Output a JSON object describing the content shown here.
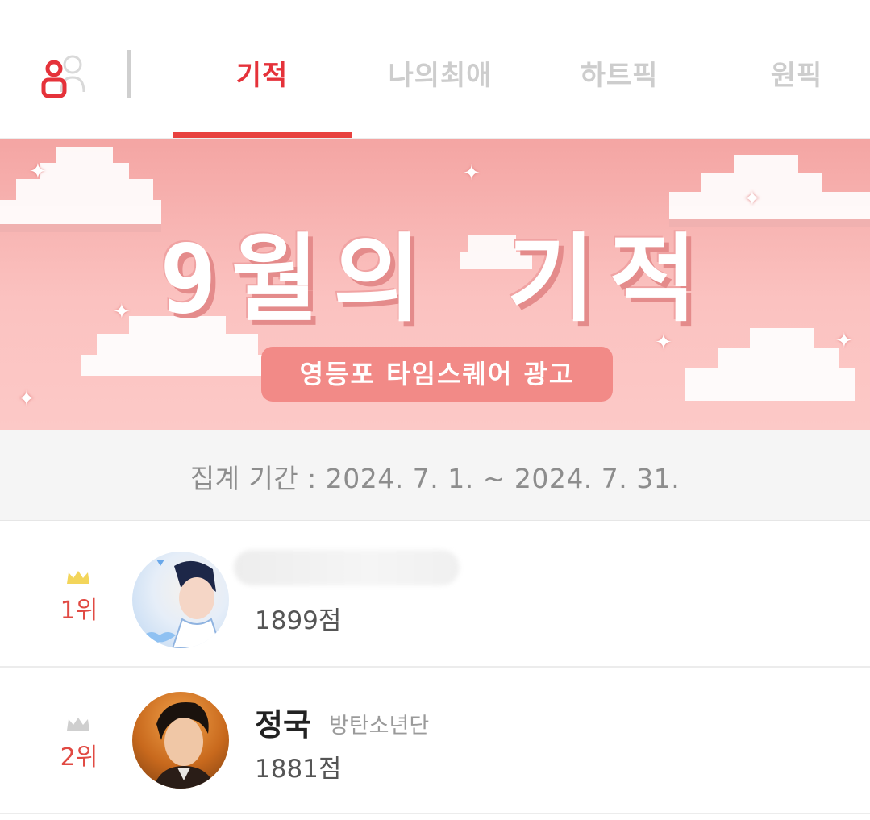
{
  "tabs": [
    {
      "label": "기적",
      "active": true
    },
    {
      "label": "나의최애",
      "active": false
    },
    {
      "label": "하트픽",
      "active": false
    },
    {
      "label": "원픽",
      "active": false
    }
  ],
  "banner": {
    "title": "9월의 기적",
    "subtitle": "영등포 타임스퀘어 광고"
  },
  "period": {
    "text": "집계 기간 :  2024. 7. 1. ~ 2024. 7. 31."
  },
  "ranking": [
    {
      "rank": "1위",
      "name": "",
      "group": "",
      "score": "1899점",
      "crown": "gold"
    },
    {
      "rank": "2위",
      "name": "정국",
      "group": "방탄소년단",
      "score": "1881점",
      "crown": "silver"
    }
  ],
  "colors": {
    "accent": "#e5323a",
    "inactive_tab": "#cdcdcd",
    "gold_crown": "#f3d55a",
    "silver_crown": "#cfcfcf",
    "banner_bg": "#f9b5b3"
  },
  "icons": {
    "user": "user-icon",
    "crown": "crown-icon",
    "sparkle": "sparkle-icon"
  }
}
